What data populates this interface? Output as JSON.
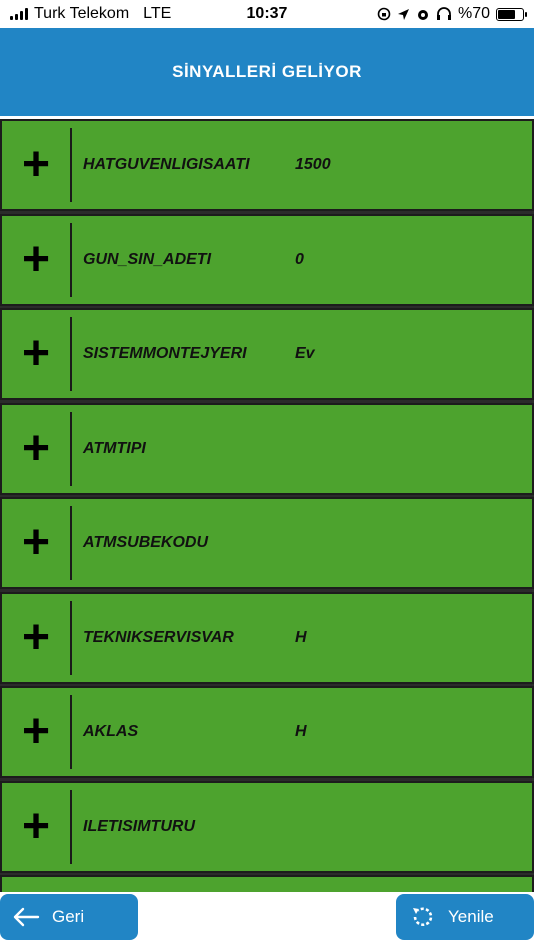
{
  "status_bar": {
    "carrier": "Turk Telekom",
    "network": "LTE",
    "time": "10:37",
    "battery": "%70",
    "battery_level": 0.7
  },
  "header": {
    "title": "SİNYALLERİ GELİYOR"
  },
  "rows": [
    {
      "label": "HATGUVENLIGISAATI",
      "value": "1500"
    },
    {
      "label": "GUN_SIN_ADETI",
      "value": "0"
    },
    {
      "label": "SISTEMMONTEJYERI",
      "value": "Ev"
    },
    {
      "label": "ATMTIPI",
      "value": ""
    },
    {
      "label": "ATMSUBEKODU",
      "value": ""
    },
    {
      "label": "TEKNIKSERVISVAR",
      "value": "H"
    },
    {
      "label": "AKLAS",
      "value": "H"
    },
    {
      "label": "ILETISIMTURU",
      "value": ""
    }
  ],
  "row_expand_symbol": "+",
  "footer": {
    "back_label": "Geri",
    "refresh_label": "Yenile"
  },
  "colors": {
    "accent": "#2185c5",
    "row_bg": "#4da32e"
  }
}
